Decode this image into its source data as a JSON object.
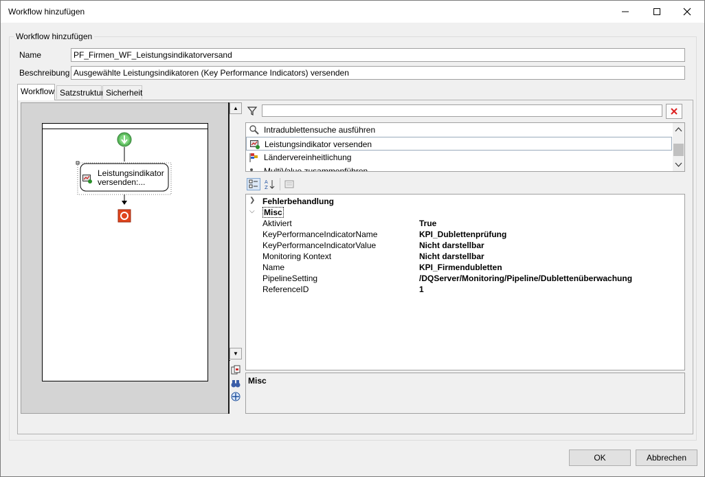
{
  "window": {
    "title": "Workflow hinzufügen"
  },
  "group": {
    "legend": "Workflow hinzufügen"
  },
  "form": {
    "name_label": "Name",
    "name_value": "PF_Firmen_WF_Leistungsindikatorversand",
    "desc_label": "Beschreibung",
    "desc_value": "Ausgewählte Leistungsindikatoren (Key Performance Indicators) versenden"
  },
  "tabs": [
    {
      "label": "Workflow"
    },
    {
      "label": "Satzstruktur"
    },
    {
      "label": "Sicherheit"
    }
  ],
  "designer": {
    "activity_line1": "Leistungsindikator",
    "activity_line2": "versenden:..."
  },
  "filter": {
    "value": ""
  },
  "activities": [
    {
      "label": "Intradublettensuche ausführen",
      "icon": "magnifier-icon"
    },
    {
      "label": "Leistungsindikator versenden",
      "icon": "kpi-send-icon"
    },
    {
      "label": "Ländervereinheitlichung",
      "icon": "flags-icon"
    },
    {
      "label": "MultiValue zusammenführen",
      "icon": "merge-icon"
    }
  ],
  "properties": {
    "categories": [
      {
        "name": "Fehlerbehandlung",
        "expanded": false
      },
      {
        "name": "Misc",
        "expanded": true
      }
    ],
    "rows": [
      {
        "name": "Aktiviert",
        "value": "True"
      },
      {
        "name": "KeyPerformanceIndicatorName",
        "value": "KPI_Dublettenprüfung"
      },
      {
        "name": "KeyPerformanceIndicatorValue",
        "value": "Nicht darstellbar"
      },
      {
        "name": "Monitoring Kontext",
        "value": "Nicht darstellbar"
      },
      {
        "name": "Name",
        "value": "KPI_Firmendubletten"
      },
      {
        "name": "PipelineSetting",
        "value": "/DQServer/Monitoring/Pipeline/Dublettenüberwachung"
      },
      {
        "name": "ReferenceID",
        "value": "1"
      }
    ],
    "description_title": "Misc"
  },
  "buttons": {
    "ok": "OK",
    "cancel": "Abbrechen"
  }
}
